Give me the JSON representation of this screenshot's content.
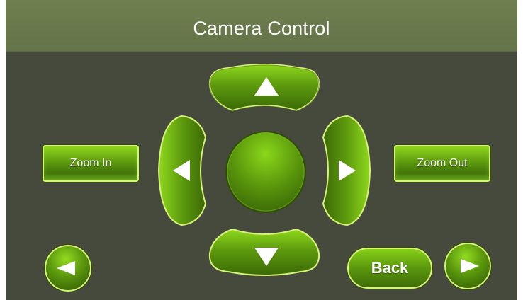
{
  "header": {
    "title": "Camera Control"
  },
  "controls": {
    "zoom_in_label": "Zoom In",
    "zoom_out_label": "Zoom Out",
    "back_label": "Back"
  },
  "icons": {
    "pan_up": "triangle-up-icon",
    "pan_down": "triangle-down-icon",
    "pan_left": "triangle-left-icon",
    "pan_right": "triangle-right-icon",
    "previous": "arrow-left-icon",
    "next": "arrow-right-icon"
  },
  "colors": {
    "background": "#464a3d",
    "header": "#6b7a4c",
    "button_green": "#5e9c0e",
    "button_highlight": "#8ed61c",
    "button_rim": "#d9f27a",
    "text": "#ffffff"
  }
}
